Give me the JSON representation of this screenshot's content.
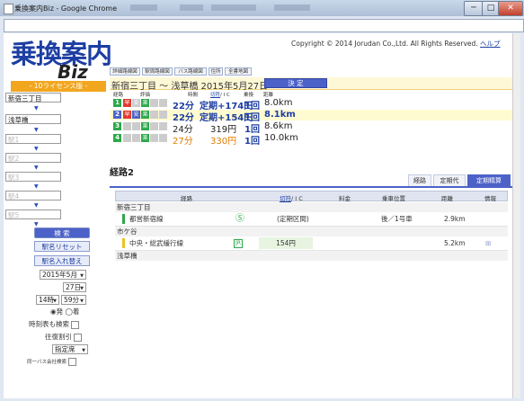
{
  "window": {
    "title": "乗換案内Biz - Google Chrome",
    "btn_min": "─",
    "btn_max": "□",
    "btn_close": "✕"
  },
  "header": {
    "logo_main": "乗換案内",
    "logo_sub": "Biz",
    "copyright": "Copyright © 2014 Jorudan Co.,Ltd. All Rights Reserved.",
    "help": "ヘルプ",
    "license": "- 10ライセンス版 -"
  },
  "sidebar": {
    "from": "新宿三丁目",
    "to": "浅草橋",
    "via_placeholders": [
      "駅1",
      "駅2",
      "駅3",
      "駅4",
      "駅5"
    ],
    "search_btn": "検 索",
    "reset_btn": "駅名リセット",
    "swap_btn": "駅名入れ替え",
    "year_month": "2015年5月",
    "day": "27日",
    "hour": "14時",
    "minute": "59分",
    "dep_label": "発",
    "arr_label": "着",
    "opt_timetable": "時刻表も検索",
    "opt_roundtrip": "往復割引",
    "seat": "指定席",
    "opt_bus": "同一バス会社検索"
  },
  "nav_tabs": [
    "詳細路線図",
    "駅周路線図",
    "バス路線図",
    "住所",
    "全書地図"
  ],
  "result": {
    "title": "新宿三丁目 ～ 浅草橋 2015年5月27日",
    "ok_btn": "決 定",
    "col_headers": {
      "route": "経路",
      "eval": "評価",
      "time": "時間",
      "fare_link": "切符",
      "fare_ic": "/ I C",
      "transfer": "乗換",
      "distance": "距離"
    },
    "routes": [
      {
        "num": "1",
        "num_color": "#2da84a",
        "badges": [
          {
            "t": "早",
            "c": "#e03a2f"
          },
          {
            "t": "安",
            "c": "#cccccc"
          },
          {
            "t": "楽",
            "c": "#2da84a"
          },
          {
            "t": "",
            "c": "#cccccc"
          },
          {
            "t": "",
            "c": "#cccccc"
          }
        ],
        "time": "22分",
        "fare": "定期+174円",
        "transfer": "1回",
        "distance": "8.0km",
        "style": "b"
      },
      {
        "num": "2",
        "num_color": "#4c62c8",
        "badges": [
          {
            "t": "早",
            "c": "#e03a2f"
          },
          {
            "t": "安",
            "c": "#4c62c8"
          },
          {
            "t": "楽",
            "c": "#2da84a"
          },
          {
            "t": "",
            "c": "#cccccc"
          },
          {
            "t": "",
            "c": "#cccccc"
          }
        ],
        "time": "22分",
        "fare": "定期+154円",
        "transfer": "1回",
        "distance": "8.1km",
        "style": "b"
      },
      {
        "num": "3",
        "num_color": "#2da84a",
        "badges": [
          {
            "t": "",
            "c": "#cccccc"
          },
          {
            "t": "",
            "c": "#cccccc"
          },
          {
            "t": "楽",
            "c": "#2da84a"
          },
          {
            "t": "",
            "c": "#cccccc"
          },
          {
            "t": "",
            "c": "#cccccc"
          }
        ],
        "time": "24分",
        "fare": "319円",
        "transfer": "1回",
        "distance": "8.6km",
        "style": "n"
      },
      {
        "num": "4",
        "num_color": "#2da84a",
        "badges": [
          {
            "t": "",
            "c": "#cccccc"
          },
          {
            "t": "",
            "c": "#cccccc"
          },
          {
            "t": "楽",
            "c": "#2da84a"
          },
          {
            "t": "",
            "c": "#cccccc"
          },
          {
            "t": "",
            "c": "#cccccc"
          }
        ],
        "time": "27分",
        "fare": "330円",
        "transfer": "1回",
        "distance": "10.0km",
        "style": "o"
      }
    ]
  },
  "detail": {
    "heading": "経路2",
    "tabs": [
      "経路",
      "定期代",
      "定期精算"
    ],
    "headers": {
      "route": "経路",
      "fare_link": "切符",
      "fare_ic": "/ I C",
      "charge": "料金",
      "car_pos": "乗車位置",
      "distance": "距離",
      "info": "情報"
    },
    "stations": [
      "新宿三丁目",
      "市ケ谷",
      "浅草橋"
    ],
    "segments": [
      {
        "line": "都営新宿線",
        "line_color": "#2da84a",
        "icon": "Ⓢ",
        "fare": "(定期区間)",
        "car_pos": "後／1号車",
        "distance": "2.9km",
        "info": ""
      },
      {
        "line": "中央・総武緩行線",
        "line_color": "#f0c020",
        "icon": "JR",
        "fare": "154円",
        "car_pos": "",
        "distance": "5.2km",
        "info": "⊞"
      }
    ]
  }
}
